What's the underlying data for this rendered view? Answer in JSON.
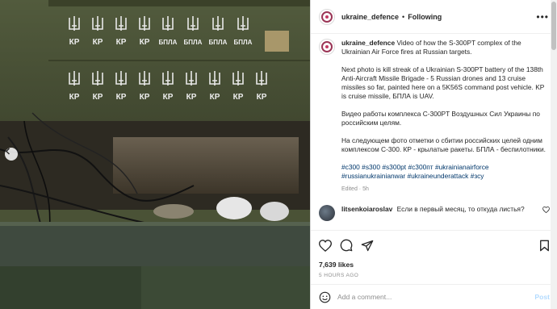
{
  "post": {
    "username": "ukraine_defence",
    "separator": "•",
    "follow_state": "Following",
    "more_label": "•••",
    "caption": {
      "username": "ukraine_defence",
      "p1": "Video of how the S-300PT complex of the Ukrainian Air Force fires at Russian targets.",
      "p2": "Next photo is kill streak of a Ukrainian S-300PT battery of the 138th Anti-Aircraft Missile Brigade - 5 Russian drones and 13 cruise missiles so far, painted here on a 5K56S command post vehicle. KP is cruise missile, БПЛА is UAV.",
      "p3": "Видео работы комплекса С-300PT Воздушных Сил Украины по российским целям.",
      "p4": "На следующем фото отметки о сбитии российских целей одним комплексом С-300. КР - крылатые ракеты. БПЛА - беспилотники.",
      "hashtags": [
        "#с300",
        "#s300",
        "#s300pt",
        "#с300пт",
        "#ukrainianairforce",
        "#russianukrainianwar",
        "#ukraineunderattack",
        "#зсу"
      ],
      "edited": "Edited · 5h"
    },
    "comment": {
      "username": "litsenkoiaroslav",
      "text": "Если в первый месяц, то откуда листья?"
    },
    "likes": "7,639 likes",
    "timestamp": "5 HOURS AGO",
    "add_comment_placeholder": "Add a comment...",
    "post_button": "Post"
  },
  "photo": {
    "marking_kp": "КР",
    "marking_bpla": "БПЛА",
    "kill_marks": {
      "cruise_missiles": 13,
      "drones": 5
    }
  },
  "colors": {
    "link": "#00376b",
    "muted": "#8e8e8e",
    "post_disabled": "#b3dbff",
    "vehicle_green": "#4a5236"
  }
}
